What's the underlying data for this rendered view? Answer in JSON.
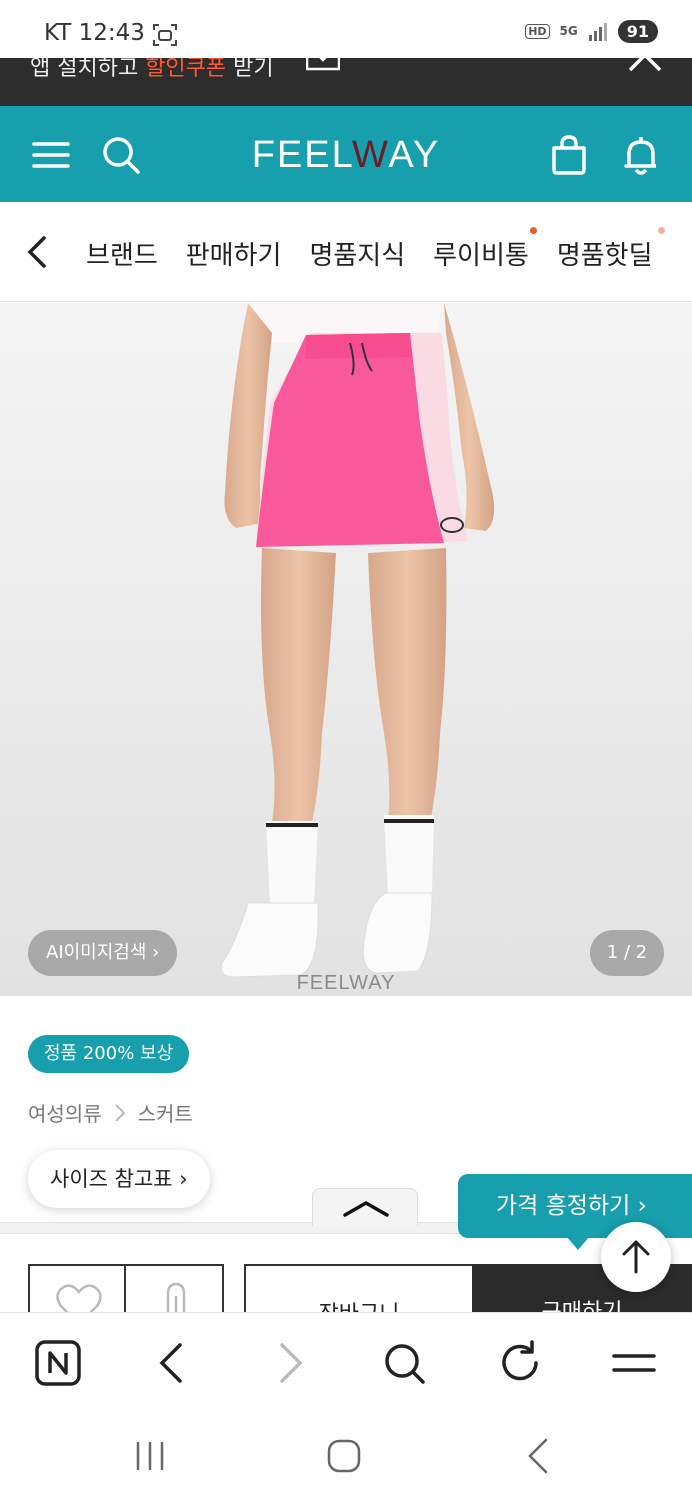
{
  "status_bar": {
    "carrier_time": "KT 12:43",
    "hd": "HD",
    "network": "5G",
    "battery": "91"
  },
  "promo": {
    "text_before": "앱 설치하고 ",
    "highlight": "할인쿠폰",
    "text_after": " 받기"
  },
  "header": {
    "logo_before": "FEEL",
    "logo_accent": "W",
    "logo_after": "AY",
    "brand_color": "#179fae"
  },
  "category_nav": {
    "items": [
      "브랜드",
      "판매하기",
      "명품지식",
      "루이비통",
      "명품핫딜"
    ]
  },
  "product_image": {
    "ai_search": "AI이미지검색 ›",
    "page_indicator": "1 / 2",
    "watermark": "FEELWAY"
  },
  "product_info": {
    "badge": "정품 200% 보상",
    "breadcrumb": [
      "여성의류",
      "스커트"
    ],
    "size_chart": "사이즈 참고표 ›",
    "price_nego": "가격 흥정하기 ›"
  },
  "action_bar": {
    "cart": "장바구니",
    "buy": "구매하기"
  }
}
